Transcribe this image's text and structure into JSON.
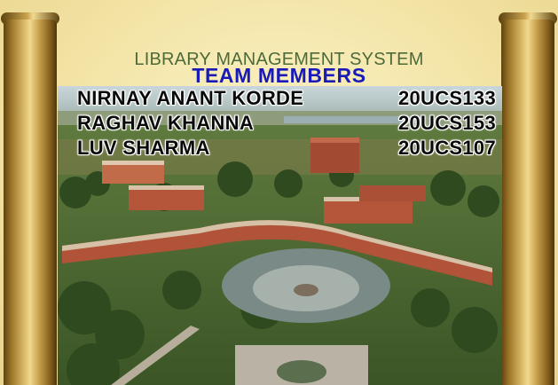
{
  "header": {
    "project_title": "LIBRARY MANAGEMENT SYSTEM",
    "team_heading": "TEAM MEMBERS"
  },
  "members": [
    {
      "name": "NIRNAY ANANT KORDE",
      "roll": "20UCS133"
    },
    {
      "name": "RAGHAV KHANNA",
      "roll": "20UCS153"
    },
    {
      "name": "LUV SHARMA",
      "roll": "20UCS107"
    }
  ],
  "colors": {
    "parchment": "#f2e5a8",
    "title_green": "#4d6a3a",
    "heading_blue": "#1a1ab8",
    "rod_gold": "#c9a34e",
    "building_brick": "#b5563a"
  }
}
